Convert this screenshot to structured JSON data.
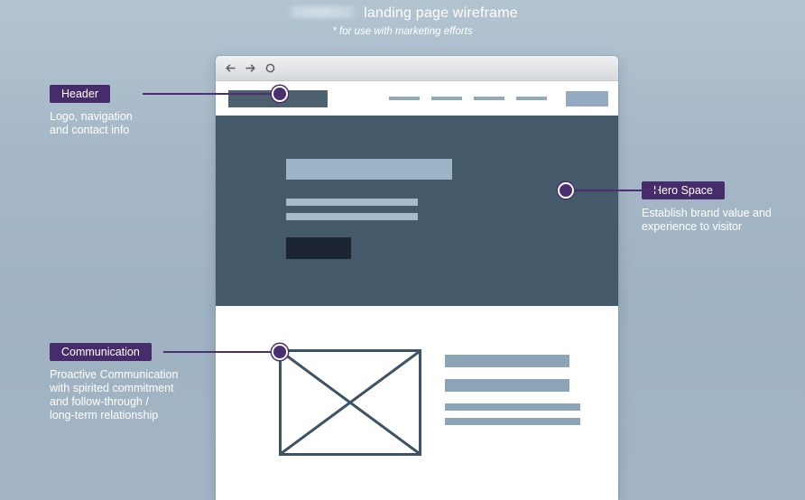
{
  "title": {
    "redacted_prefix": true,
    "text": "landing page wireframe",
    "subtitle": "* for use with marketing efforts"
  },
  "browser": {
    "chrome_icons": [
      "back-arrow-icon",
      "forward-arrow-icon",
      "reload-icon"
    ]
  },
  "wireframe": {
    "header": {
      "logo_placeholder": "logo-block",
      "nav_link_count": 4,
      "cta_placeholder": "nav-cta-block"
    },
    "hero": {
      "headline_placeholder": "hero-headline-block",
      "body_line_count": 2,
      "cta_placeholder": "hero-cta-block"
    },
    "content": {
      "image_placeholder": "image-placeholder-x-box",
      "thick_bar_count": 2,
      "thin_bar_count": 2
    }
  },
  "callouts": [
    {
      "id": "header",
      "label": "Header",
      "description": "Logo, navigation\nand contact info"
    },
    {
      "id": "hero",
      "label": "Hero Space",
      "description": "Establish brand value and\nexperience to visitor"
    },
    {
      "id": "communication",
      "label": "Communication",
      "description": "Proactive Communication\nwith spirited commitment\nand follow-through /\nlong-term relationship"
    }
  ],
  "colors": {
    "background": "#a3b6c6",
    "accent_purple": "#462c6b",
    "hero_dark": "#44596a",
    "placeholder_blue": "#8ba4b8",
    "cta_dark": "#1b2430"
  }
}
